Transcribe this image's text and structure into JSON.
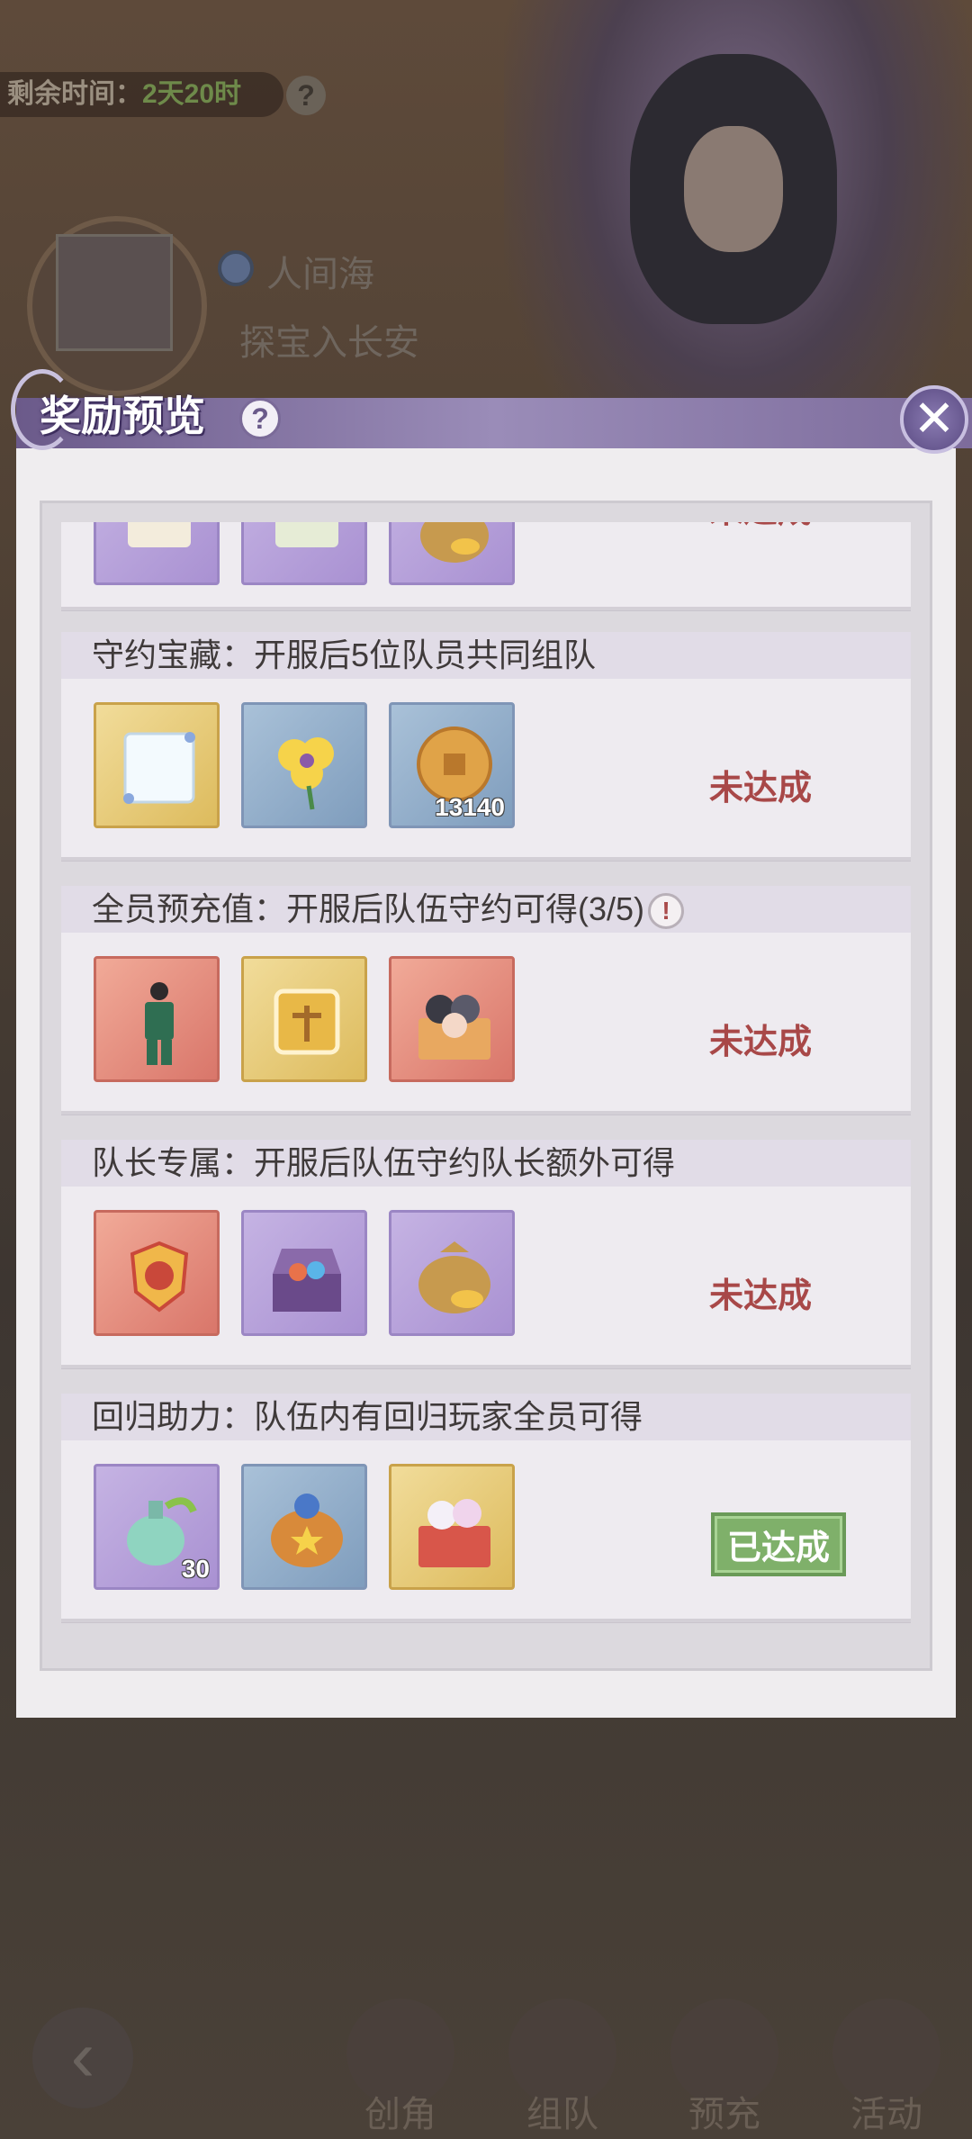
{
  "background": {
    "timer_label": "剩余时间：",
    "timer_value": "2天20时",
    "help_icon": "?",
    "server_name": "人间海",
    "server_subtitle": "探宝入长安"
  },
  "modal": {
    "title": "奖励预览",
    "help_icon": "?",
    "close_icon": "✕"
  },
  "rewards": [
    {
      "title": "",
      "status": "未达成",
      "items": [
        {
          "icon": "scroll-icon",
          "qty": ""
        },
        {
          "icon": "map-scroll-icon",
          "qty": ""
        },
        {
          "icon": "gold-bag-icon",
          "qty": ""
        }
      ]
    },
    {
      "title": "守约宝藏：开服后5位队员共同组队",
      "status": "未达成",
      "items": [
        {
          "icon": "frame-icon",
          "qty": ""
        },
        {
          "icon": "flower-icon",
          "qty": ""
        },
        {
          "icon": "coin-icon",
          "qty": "13140"
        }
      ]
    },
    {
      "title": "全员预充值：开服后队伍守约可得(3/5)",
      "status": "未达成",
      "items": [
        {
          "icon": "outfit-icon",
          "qty": ""
        },
        {
          "icon": "team-badge-icon",
          "qty": ""
        },
        {
          "icon": "gift-box-icon",
          "qty": ""
        }
      ]
    },
    {
      "title": "队长专属：开服后队伍守约队长额外可得",
      "status": "未达成",
      "items": [
        {
          "icon": "captain-badge-icon",
          "qty": ""
        },
        {
          "icon": "treasure-chest-icon",
          "qty": ""
        },
        {
          "icon": "gold-bag-icon",
          "qty": ""
        }
      ]
    },
    {
      "title": "回归助力：队伍内有回归玩家全员可得",
      "status": "已达成",
      "items": [
        {
          "icon": "potion-icon",
          "qty": "30"
        },
        {
          "icon": "star-bag-icon",
          "qty": ""
        },
        {
          "icon": "pet-box-icon",
          "qty": ""
        }
      ]
    }
  ],
  "warn_icon": "!",
  "nav": {
    "back_icon": "‹",
    "items": [
      "创角",
      "组队",
      "预充",
      "活动"
    ]
  }
}
